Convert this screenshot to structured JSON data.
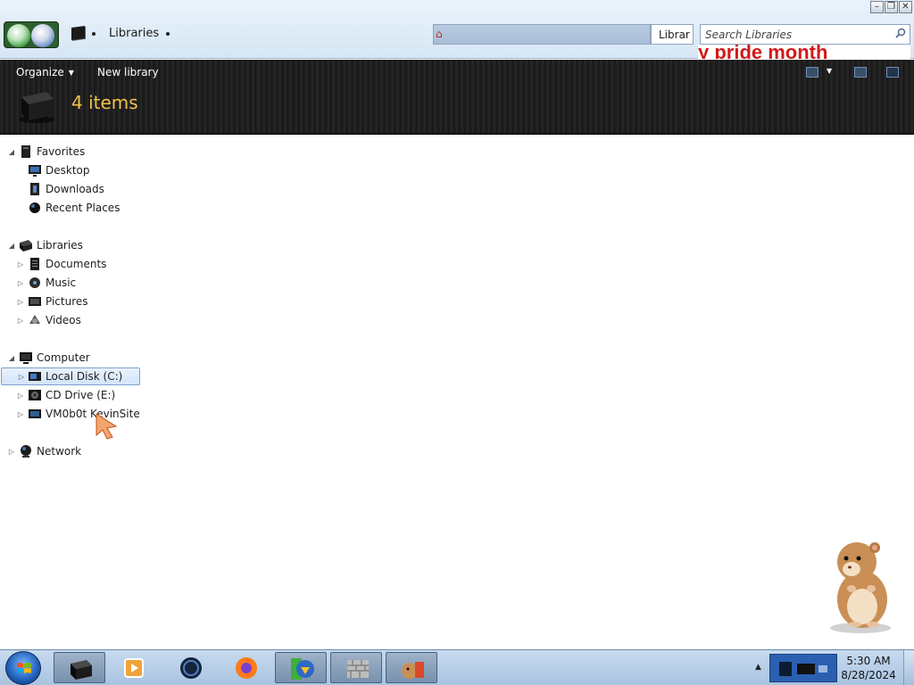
{
  "window": {
    "controls": {
      "minimize": "–",
      "restore": "❐",
      "close": "✕"
    }
  },
  "address": {
    "location": "Libraries",
    "tail_text": "Librar"
  },
  "search": {
    "placeholder": "Search Libraries"
  },
  "banner": {
    "text": "y pride month"
  },
  "toolbar": {
    "organize_label": "Organize",
    "new_library_label": "New library",
    "item_count": "4 items"
  },
  "tree": {
    "favorites": {
      "label": "Favorites",
      "items": [
        {
          "label": "Desktop"
        },
        {
          "label": "Downloads"
        },
        {
          "label": "Recent Places"
        }
      ]
    },
    "libraries": {
      "label": "Libraries",
      "items": [
        {
          "label": "Documents"
        },
        {
          "label": "Music"
        },
        {
          "label": "Pictures"
        },
        {
          "label": "Videos"
        }
      ]
    },
    "computer": {
      "label": "Computer",
      "items": [
        {
          "label": "Local Disk (C:)",
          "selected": true
        },
        {
          "label": "CD Drive (E:)"
        },
        {
          "label": "VM0b0t KevinSite"
        }
      ]
    },
    "network": {
      "label": "Network"
    }
  },
  "taskbar": {
    "apps": [
      {
        "icon": "libraries-icon",
        "active": true
      },
      {
        "icon": "media-player-icon",
        "active": false
      },
      {
        "icon": "globe-icon",
        "active": false
      },
      {
        "icon": "firefox-icon",
        "active": false
      },
      {
        "icon": "internet-download-manager-icon",
        "active": true
      },
      {
        "icon": "firewall-icon",
        "active": true
      },
      {
        "icon": "hamster-app-icon",
        "active": true
      }
    ],
    "clock": {
      "time": "5:30 AM",
      "date": "8/28/2024"
    }
  },
  "colors": {
    "item_count": "#f2c14a",
    "selection_border": "#7da2ce",
    "banner_text": "#d21a1a"
  }
}
